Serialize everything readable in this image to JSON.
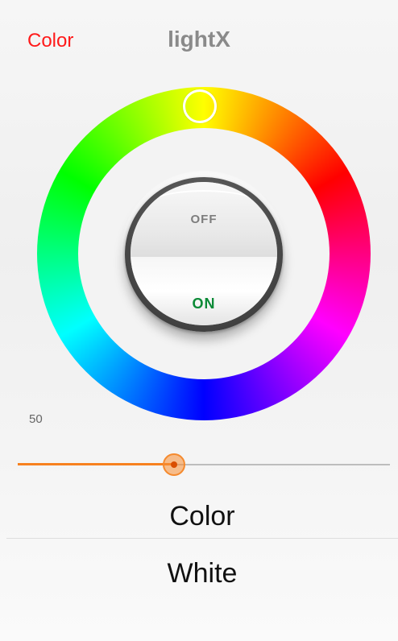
{
  "header": {
    "color_label": "Color",
    "title": "lightX"
  },
  "power_switch": {
    "off_label": "OFF",
    "on_label": "ON",
    "state": "ON"
  },
  "color_wheel": {
    "selected_hue_color": "#00ff00"
  },
  "brightness": {
    "value_label": "50",
    "fraction": 0.42,
    "accent_color": "#f7811f"
  },
  "modes": {
    "color_label": "Color",
    "white_label": "White"
  }
}
